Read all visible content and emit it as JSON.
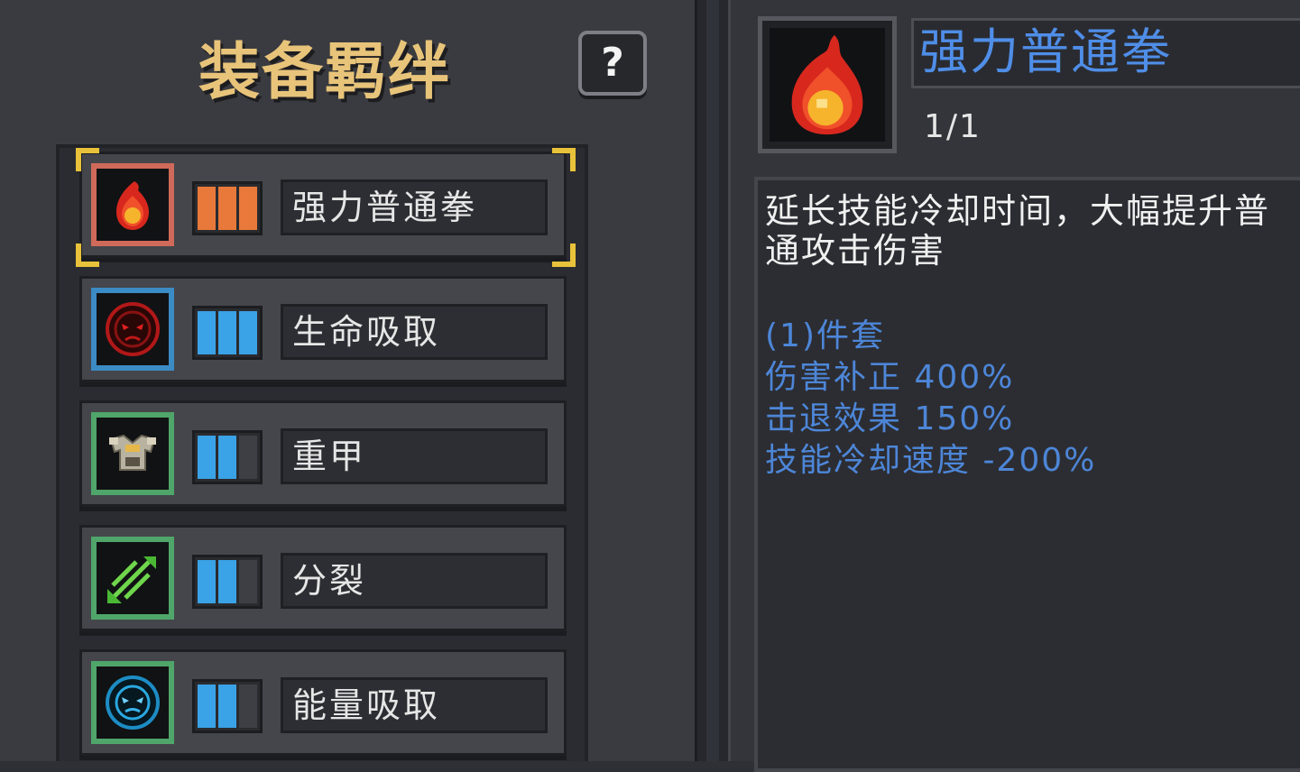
{
  "panel": {
    "title": "装备羁绊",
    "help_label": "?"
  },
  "colors": {
    "accent_gold": "#e8c23a",
    "title_gold": "#e8c47a",
    "bonus_blue": "#4d86d8",
    "name_blue": "#4f8ee8",
    "orange": "#e9793a",
    "cyan": "#3aa2e6"
  },
  "bonds": [
    {
      "name": "强力普通拳",
      "icon": "flame-icon",
      "filled": 3,
      "total": 3,
      "bar_color": "#e9793a",
      "border_color": "#cf6a5a",
      "selected": true
    },
    {
      "name": "生命吸取",
      "icon": "red-skull-icon",
      "filled": 3,
      "total": 3,
      "bar_color": "#3aa2e6",
      "border_color": "#3b8bc4",
      "selected": false
    },
    {
      "name": "重甲",
      "icon": "armor-icon",
      "filled": 2,
      "total": 3,
      "bar_color": "#3aa2e6",
      "border_color": "#4fa56a",
      "selected": false
    },
    {
      "name": "分裂",
      "icon": "split-arrows-icon",
      "filled": 2,
      "total": 3,
      "bar_color": "#3aa2e6",
      "border_color": "#4fa56a",
      "selected": false
    },
    {
      "name": "能量吸取",
      "icon": "energy-orb-icon",
      "filled": 2,
      "total": 3,
      "bar_color": "#3aa2e6",
      "border_color": "#4fa56a",
      "selected": false
    }
  ],
  "detail": {
    "name": "强力普通拳",
    "count": "1/1",
    "description": "延长技能冷却时间，大幅提升普通攻击伤害",
    "set_title": "(1)件套",
    "bonuses": [
      "伤害补正 400%",
      "击退效果 150%",
      "技能冷却速度 -200%"
    ]
  }
}
